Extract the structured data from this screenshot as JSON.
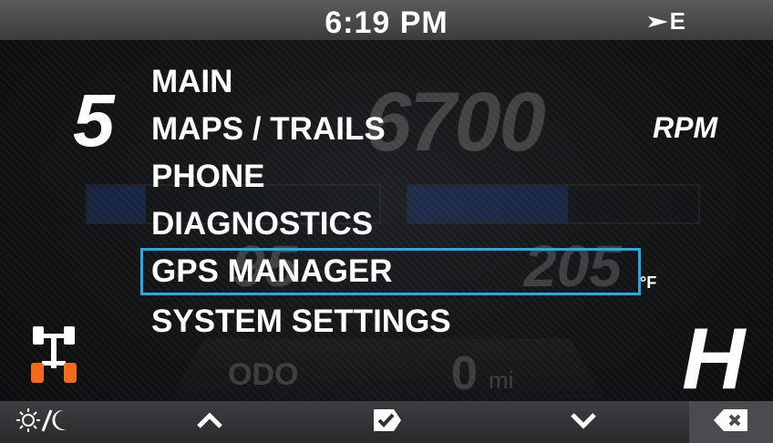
{
  "status_bar": {
    "time": "6:19 PM",
    "heading": "E"
  },
  "gauges": {
    "gear": "5",
    "rpm_value": "6700",
    "rpm_label": "RPM",
    "temperature_value": "205",
    "temperature_unit": "°F",
    "left_gauge_value": "95",
    "odometer_label": "ODO",
    "odometer_value": "0",
    "odometer_unit": "mi",
    "drive_mode": "H"
  },
  "menu": {
    "items": [
      {
        "label": "MAIN",
        "selected": false
      },
      {
        "label": "MAPS / TRAILS",
        "selected": false
      },
      {
        "label": "PHONE",
        "selected": false
      },
      {
        "label": "DIAGNOSTICS",
        "selected": false
      },
      {
        "label": "GPS MANAGER",
        "selected": true
      },
      {
        "label": "SYSTEM SETTINGS",
        "selected": false
      }
    ],
    "highlight_color": "#29a8e6"
  },
  "bottom_bar": {
    "buttons": [
      {
        "icon": "day-night-icon"
      },
      {
        "icon": "chevron-up-icon"
      },
      {
        "icon": "select-check-icon"
      },
      {
        "icon": "chevron-down-icon"
      },
      {
        "icon": "back-delete-icon"
      }
    ]
  },
  "colors": {
    "accent": "#29a8e6",
    "awd_wheels": "#f26a1b",
    "rpm_bar": "#2a5fd8"
  }
}
